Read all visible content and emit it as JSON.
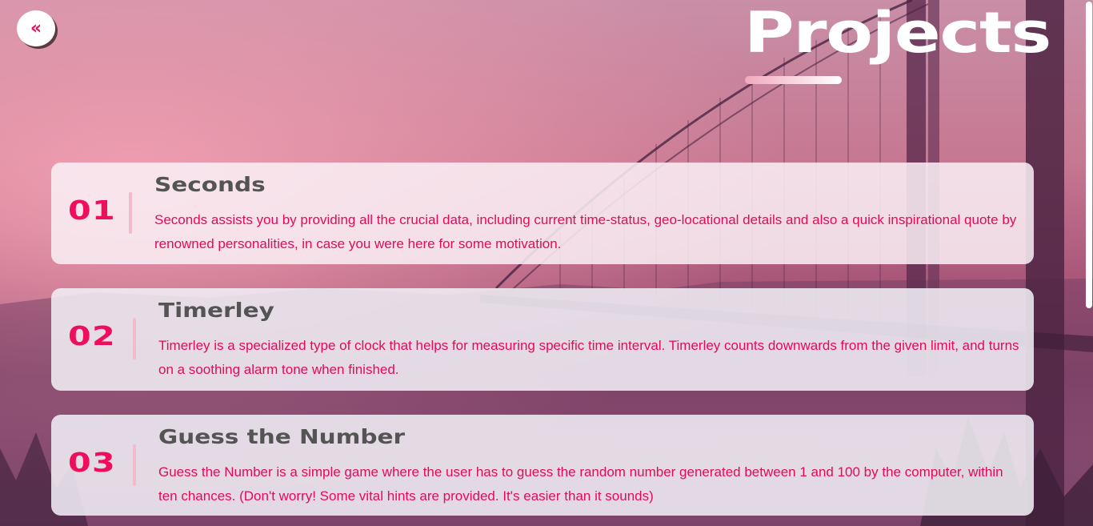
{
  "header": {
    "back_icon": "«",
    "title": "Projects"
  },
  "projects": [
    {
      "number": "01",
      "title": "Seconds",
      "description": "Seconds assists you by providing all the crucial data, including current time-status, geo-locational details and also a quick inspirational quote by renowned personalities, in case you were here for some motivation."
    },
    {
      "number": "02",
      "title": "Timerley",
      "description": "Timerley is a specialized type of clock that helps for measuring specific time interval. Timerley counts downwards from the given limit, and turns on a soothing alarm tone when finished."
    },
    {
      "number": "03",
      "title": "Guess the Number",
      "description": "Guess the Number is a simple game where the user has to guess the random number generated between 1 and 100 by the computer, within ten chances. (Don't worry! Some vital hints are provided. It's easier than it sounds)"
    }
  ],
  "colors": {
    "accent": "#ee0e5c",
    "title_text": "#545454",
    "heading": "#ffffff"
  },
  "icons": {
    "back": "double-chevron-left-icon"
  }
}
